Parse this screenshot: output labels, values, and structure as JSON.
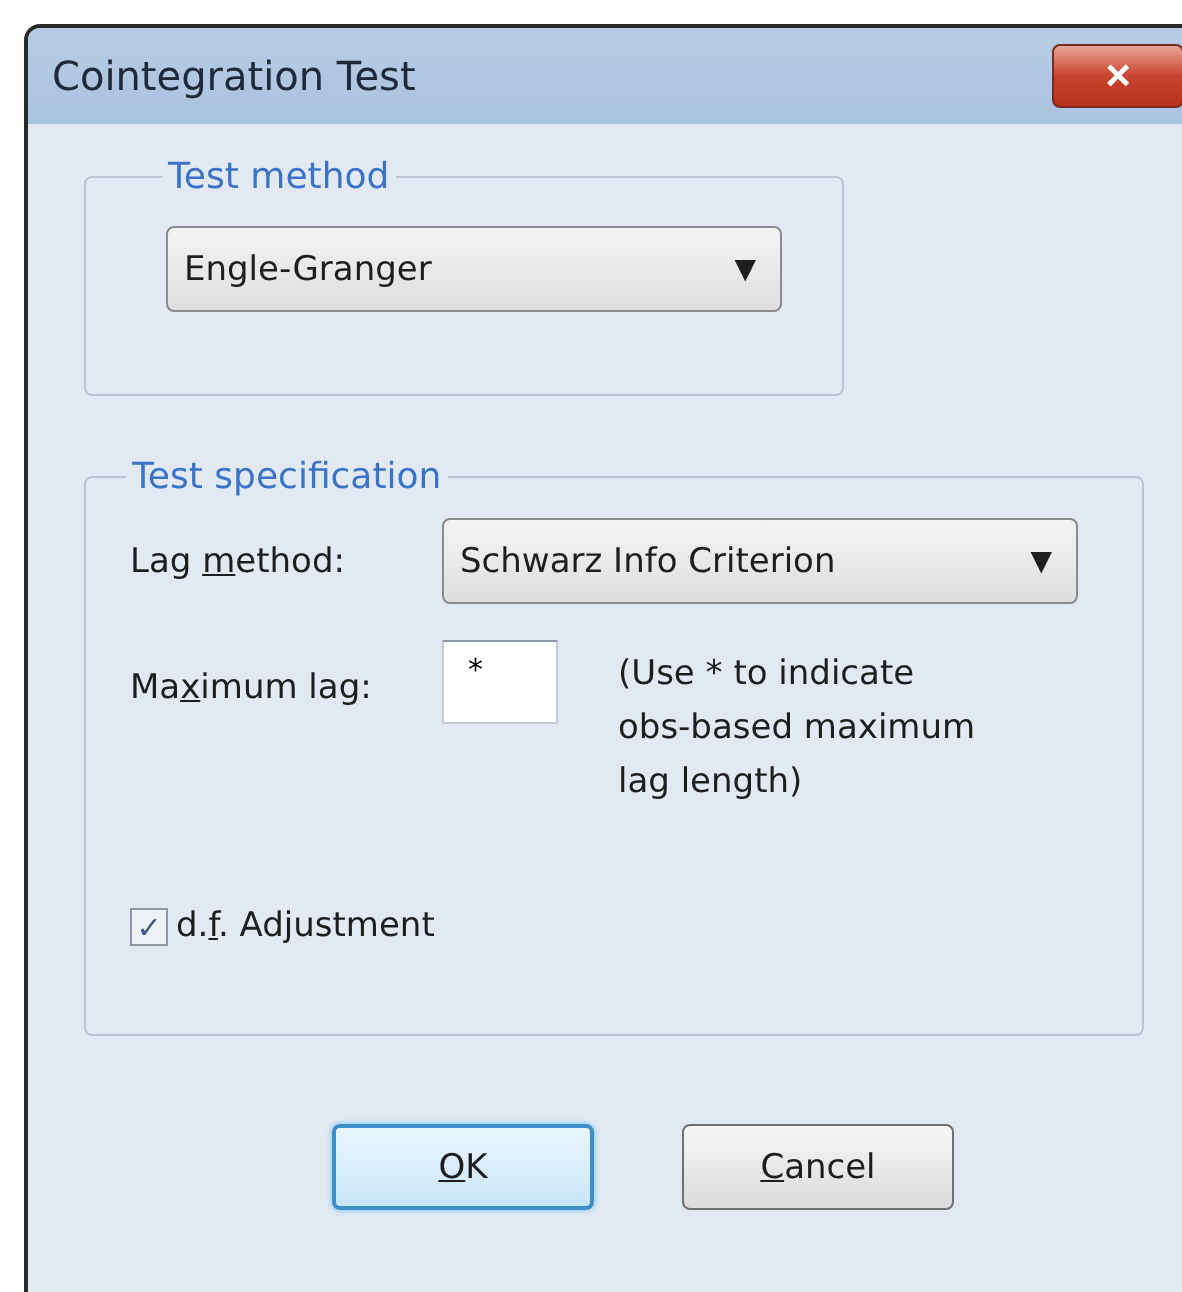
{
  "window": {
    "title": "Cointegration Test",
    "close": "×"
  },
  "test_method": {
    "legend": "Test method",
    "dropdown": {
      "value": "Engle-Granger",
      "arrow": "▼"
    }
  },
  "test_specification": {
    "legend": "Test specification",
    "lag_method": {
      "label": {
        "pre": "Lag ",
        "key": "m",
        "post": "ethod:"
      },
      "value": "Schwarz Info Criterion",
      "arrow": "▼"
    },
    "maximum_lag": {
      "label": {
        "pre": "Ma",
        "key": "x",
        "post": "imum lag:"
      },
      "value": "*",
      "hint": "(Use * to indicate obs-based maximum lag length)"
    },
    "df_adjustment": {
      "label": {
        "pre": "d.",
        "key": "f",
        "post": ". Adjustment"
      },
      "checked": true,
      "tick": "✓"
    }
  },
  "buttons": [
    {
      "label": {
        "key": "O",
        "post": "K"
      },
      "default": true
    },
    {
      "label": {
        "key": "C",
        "post": "ancel"
      },
      "default": false
    }
  ]
}
